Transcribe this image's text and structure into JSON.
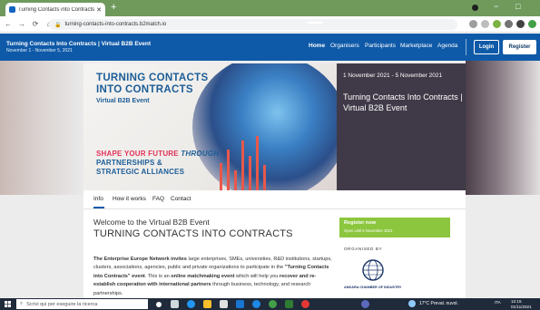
{
  "browser": {
    "tab_title": "Turning Contacts into Contracts",
    "tab_close": "✕",
    "new_tab": "+",
    "url": "turning-contacts-into-contracts.b2match.io",
    "minimize": "−",
    "maximize": "□"
  },
  "site": {
    "title": "Turning Contacts Into Contracts | Virtual B2B Event",
    "dates": "November 1 - November 5, 2021",
    "nav": [
      "Home",
      "Organisers",
      "Participants",
      "Marketplace",
      "Agenda"
    ],
    "login": "Login",
    "register": "Register"
  },
  "banner": {
    "line1": "TURNING CONTACTS",
    "line2": "INTO CONTRACTS",
    "subtitle": "Virtual B2B Event",
    "tag1a": "SHAPE YOUR FUTURE ",
    "tag1b": "THROUGH",
    "tag2": "PARTNERSHIPS &",
    "tag3": "STRATEGIC ALLIANCES"
  },
  "event": {
    "dates": "1 November 2021 - 5 November 2021",
    "name": "Turning Contacts Into Contracts | Virtual B2B Event"
  },
  "content": {
    "tabs": [
      "Info",
      "How it works",
      "FAQ",
      "Contact"
    ],
    "welcome": "Welcome to the Virtual B2B Event",
    "heading": "TURNING CONTACTS INTO CONTRACTS",
    "p_bold1": "The Enterprise Europe Network invites",
    "p_text1": " large enterprises, SMEs, universities, R&D institutions, startups, clusters, associations, agencies, public and private organizations to participate in the ",
    "p_bold2": "\"Turning Contacts into Contracts\" event",
    "p_text2": ". This is an ",
    "p_bold3": "online matchmaking event",
    "p_text3": " which will help you ",
    "p_bold4": "recover and re-establish cooperation with international partners",
    "p_text4": " through business, technology, and research partnerships."
  },
  "sidebar": {
    "register_now": "Register now",
    "open_until": "Open until 5 November 2021",
    "organised_by": "ORGANISED BY",
    "org_name": "ANKARA CHAMBER OF INDUSTRY"
  },
  "taskbar": {
    "search_placeholder": "Scrivi qui per eseguire la ricerca",
    "weather": "17°C Preval. nuvol.",
    "lang": "ITA",
    "time": "12:15",
    "date": "01/11/2021"
  },
  "colors": {
    "site_blue": "#0f5aa8",
    "register_green": "#8cc63f",
    "banner_red": "#e2325a"
  }
}
